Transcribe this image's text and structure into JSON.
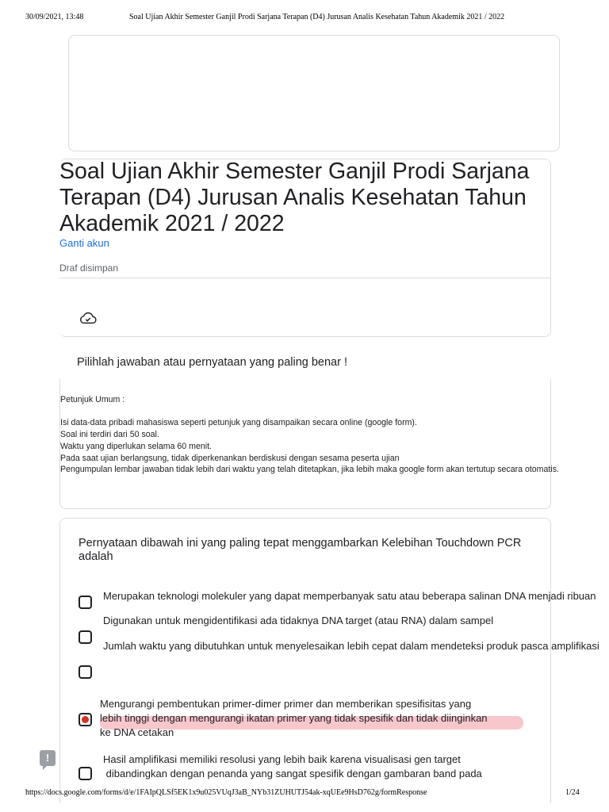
{
  "print_header": {
    "date": "30/09/2021, 13:48",
    "title": "Soal Ujian Akhir Semester Ganjil Prodi Sarjana Terapan (D4) Jurusan Analis Kesehatan Tahun Akademik 2021 / 2022"
  },
  "form": {
    "title": "Soal Ujian Akhir Semester Ganjil Prodi Sarjana Terapan (D4) Jurusan Analis Kesehatan Tahun Akademik 2021 / 2022",
    "switch_account": "Ganti akun",
    "draft_status": "Draf disimpan"
  },
  "section": {
    "description": "Pilihlah jawaban atau pernyataan yang paling benar !"
  },
  "instructions": {
    "lines": [
      "Petunjuk Umum :",
      "",
      "Isi data-data pribadi mahasiswa seperti petunjuk yang disampaikan secara online (google form).",
      "Soal ini terdiri dari 50 soal.",
      "Waktu yang diperlukan selama 60 menit.",
      "Pada saat ujian berlangsung, tidak diperkenankan berdiskusi dengan sesama peserta ujian",
      "Pengumpulan lembar jawaban tidak lebih dari waktu yang telah ditetapkan, jika lebih maka google form akan tertutup secara otomatis."
    ]
  },
  "question": {
    "text": "Pernyataan dibawah ini yang paling tepat menggambarkan Kelebihan Touchdown PCR adalah",
    "options": [
      {
        "label": "Merupakan teknologi molekuler yang dapat memperbanyak satu atau beberapa salinan DNA menjadi ribuan",
        "checked": false
      },
      {
        "label": "Digunakan untuk mengidentifikasi ada tidaknya DNA target (atau RNA) dalam sampel",
        "checked": false
      },
      {
        "label": "Jumlah waktu yang dibutuhkan untuk menyelesaikan lebih cepat dalam mendeteksi produk pasca amplifikasi",
        "checked": false
      },
      {
        "label": "",
        "checked": false
      },
      {
        "label": "Mengurangi pembentukan primer-dimer primer dan memberikan spesifisitas yang\nlebih tinggi dengan mengurangi ikatan primer yang tidak spesifik dan tidak diinginkan\nke DNA cetakan",
        "checked": true
      },
      {
        "label": "Hasil amplifikasi memiliki resolusi yang lebih baik karena visualisasi gen target\n dibandingkan dengan penanda yang sangat spesifik dengan gambaran band pada",
        "checked": false
      }
    ]
  },
  "print_footer": {
    "url": "https://docs.google.com/forms/d/e/1FAIpQLSf5EK1x9u025VUqJ3aB_NYb31ZUHUTJ54ak-xqUEe9HsD762g/formResponse",
    "page": "1/24"
  },
  "icons": {
    "cloud": "cloud-saved-icon",
    "report": "report-problem-icon"
  },
  "colors": {
    "link": "#1a73e8",
    "border": "#dadce0",
    "selected": "#d93025",
    "highlight": "#f8c7cc"
  }
}
